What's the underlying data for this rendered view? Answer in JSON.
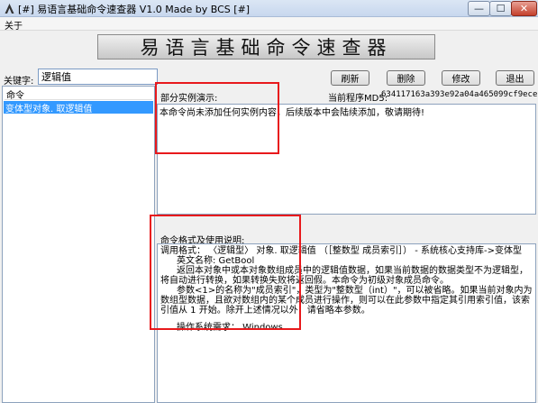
{
  "window": {
    "title": "[#] 易语言基础命令速查器 V1.0 Made by BCS [#]",
    "min_glyph": "—",
    "max_glyph": "☐",
    "close_glyph": "✕"
  },
  "menu": {
    "about": "关于"
  },
  "banner": {
    "text": "易语言基础命令速查器"
  },
  "search": {
    "label": "关键字:",
    "value": "逻辑值"
  },
  "list": {
    "header": "命令",
    "items": [
      "变体型对象. 取逻辑值"
    ]
  },
  "toolbar": {
    "refresh": "刷新",
    "delete": "删除",
    "modify": "修改",
    "exit": "退出"
  },
  "example": {
    "label": "部分实例演示:",
    "md5_label": "当前程序MD5:",
    "md5_value": "634117163a393e92a04a465099cf9ece",
    "text": "本命令尚未添加任何实例内容，后续版本中会陆续添加，敬请期待!"
  },
  "format": {
    "label": "命令格式及使用说明:",
    "call_format": "调用格式： 〈逻辑型〉 对象. 取逻辑值 （［整数型 成员索引］） - 系统核心支持库->变体型",
    "english_name": "英文名称: GetBool",
    "desc1": "返回本对象中或本对象数组成员中的逻辑值数据，如果当前数据的数据类型不为逻辑型，将自动进行转换，如果转换失败将返回假。本命令为初级对象成员命令。",
    "desc2": "参数<1>的名称为\"成员索引\"，类型为\"整数型（int）\"，可以被省略。如果当前对象内为数组型数据，且欲对数组内的某个成员进行操作，则可以在此参数中指定其引用索引值，该索引值从 1 开始。除开上述情况以外，请省略本参数。",
    "os_requirement": "操作系统需求：  Windows"
  },
  "colors": {
    "selection": "#3399ff",
    "annotation_red": "#e8191c",
    "border_blue": "#8da2bd"
  }
}
